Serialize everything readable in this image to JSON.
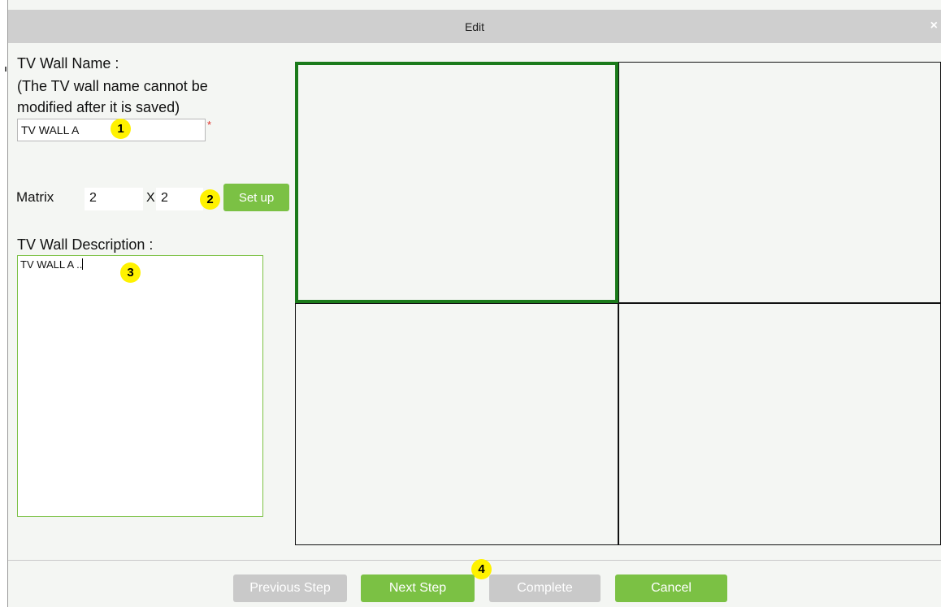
{
  "dialog": {
    "title": "Edit",
    "close_glyph": "×"
  },
  "form": {
    "name_label_line1": "TV Wall Name :",
    "name_label_line2": "(The TV wall name cannot be",
    "name_label_line3": "modified after it is saved)",
    "name_value": "TV WALL A",
    "required_marker": "*",
    "matrix_label": "Matrix",
    "matrix_rows": "2",
    "matrix_x_label": "X",
    "matrix_cols": "2",
    "setup_label": "Set up",
    "description_label": "TV Wall Description :",
    "description_value": "TV WALL A .."
  },
  "annotations": [
    "1",
    "2",
    "3",
    "4"
  ],
  "wall_grid": {
    "rows": 2,
    "cols": 2,
    "selected_cell": [
      0,
      0
    ],
    "selected_color": "#1a7a1a"
  },
  "footer": {
    "previous_label": "Previous Step",
    "next_label": "Next Step",
    "complete_label": "Complete",
    "cancel_label": "Cancel"
  },
  "colors": {
    "accent": "#7bc144",
    "disabled": "#c9c9c9",
    "badge": "#fff200"
  }
}
